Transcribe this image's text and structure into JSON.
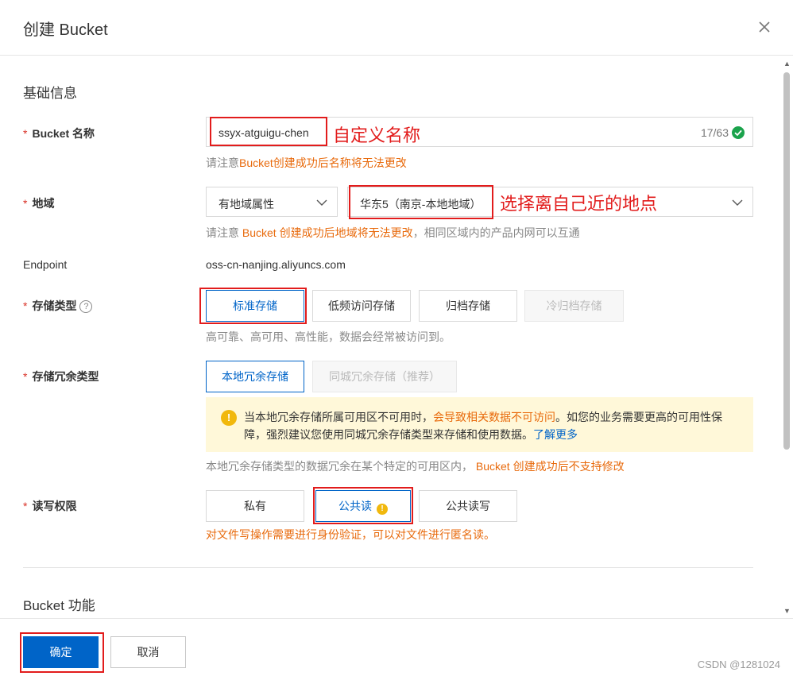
{
  "dialog": {
    "title": "创建 Bucket"
  },
  "basic": {
    "section_title": "基础信息",
    "bucket_name": {
      "label": "Bucket 名称",
      "value": "ssyx-atguigu-chen",
      "count": "17/63",
      "annotation": "自定义名称",
      "hint_prefix": "请注意",
      "hint_warn": "Bucket创建成功后名称将无法更改"
    },
    "region": {
      "label": "地域",
      "attr_select": "有地域属性",
      "region_select": "华东5（南京-本地地域）",
      "annotation": "选择离自己近的地点",
      "hint_prefix": "请注意 ",
      "hint_warn": "Bucket 创建成功后地域将无法更改",
      "hint_suffix": "，相同区域内的产品内网可以互通"
    },
    "endpoint": {
      "label": "Endpoint",
      "value": "oss-cn-nanjing.aliyuncs.com"
    },
    "storage_class": {
      "label": "存储类型",
      "help": "?",
      "options": [
        "标准存储",
        "低频访问存储",
        "归档存储",
        "冷归档存储"
      ],
      "hint": "高可靠、高可用、高性能，数据会经常被访问到。"
    },
    "redundancy": {
      "label": "存储冗余类型",
      "options": [
        "本地冗余存储",
        "同城冗余存储（推荐）"
      ],
      "notice": {
        "icon": "!",
        "part1": "当本地冗余存储所属可用区不可用时，",
        "warn": "会导致相关数据不可访问",
        "part2": "。如您的业务需要更高的可用性保障，强烈建议您使用同城冗余存储类型来存储和使用数据。",
        "link": "了解更多"
      },
      "hint_prefix": "本地冗余存储类型的数据冗余在某个特定的可用区内， ",
      "hint_warn": "Bucket 创建成功后不支持修改"
    },
    "acl": {
      "label": "读写权限",
      "options": [
        "私有",
        "公共读",
        "公共读写"
      ],
      "warn_icon": "!",
      "hint": "对文件写操作需要进行身份验证，可以对文件进行匿名读。"
    }
  },
  "features": {
    "section_title": "Bucket 功能"
  },
  "footer": {
    "confirm": "确定",
    "cancel": "取消",
    "watermark": "CSDN @1281024"
  },
  "colors": {
    "primary": "#0064c8",
    "warning": "#e86a0c",
    "annotation": "#e21c1c",
    "notice_bg": "#fff8d9"
  }
}
